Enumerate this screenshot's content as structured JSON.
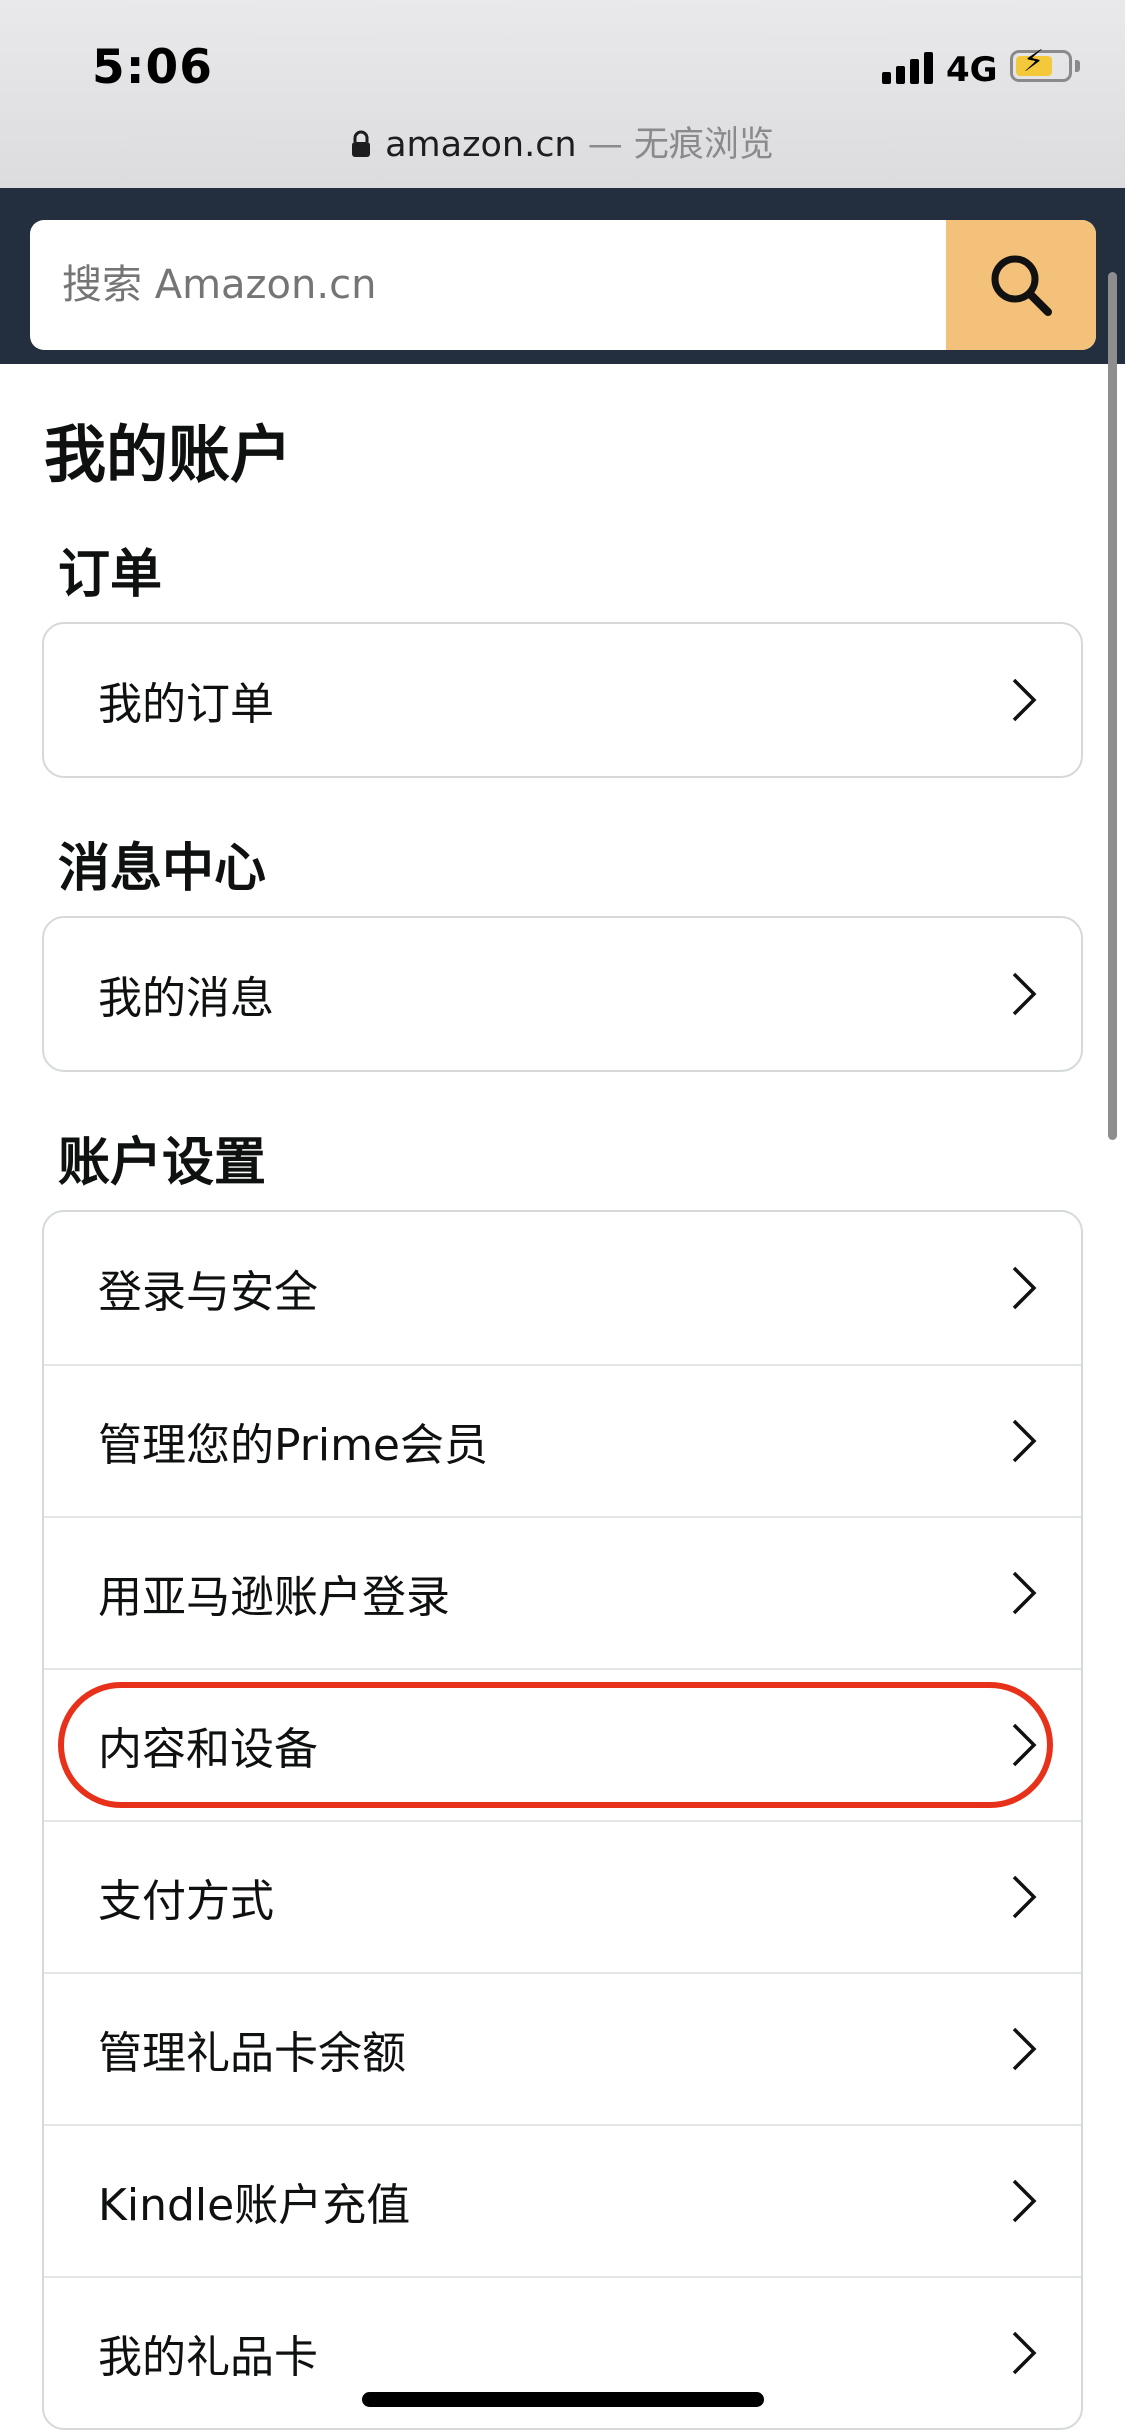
{
  "status_bar": {
    "time": "5:06",
    "network": "4G"
  },
  "browser": {
    "domain": "amazon.cn",
    "mode": " — 无痕浏览"
  },
  "search": {
    "placeholder": "搜索 Amazon.cn"
  },
  "account": {
    "title": "我的账户",
    "sections": {
      "orders": {
        "title": "订单",
        "items": [
          "我的订单"
        ]
      },
      "messages": {
        "title": "消息中心",
        "items": [
          "我的消息"
        ]
      },
      "settings": {
        "title": "账户设置",
        "items": [
          "登录与安全",
          "管理您的Prime会员",
          "用亚马逊账户登录",
          "内容和设备",
          "支付方式",
          "管理礼品卡余额",
          "Kindle账户充值",
          "我的礼品卡"
        ]
      }
    }
  },
  "colors": {
    "header_bg": "#232f3e",
    "search_button": "#f3c17a",
    "highlight_ring": "#e8311a",
    "battery_fill": "#f3c93b"
  },
  "icons": {
    "search": "search-icon",
    "chevron": "chevron-right-icon",
    "lock": "lock-icon",
    "signal": "signal-icon",
    "battery": "battery-charging-icon"
  }
}
